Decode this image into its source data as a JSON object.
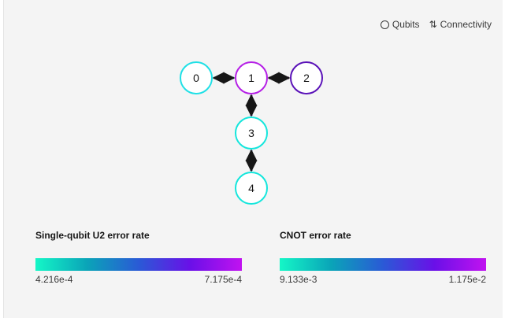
{
  "legend": {
    "qubits_label": "Qubits",
    "connectivity_label": "Connectivity",
    "qubits_icon": "circle-outline-icon",
    "connectivity_icon": "swap-vertical-icon"
  },
  "topology": {
    "nodes": [
      {
        "id": "0",
        "color": "#1fe0e6"
      },
      {
        "id": "1",
        "color": "#b51fe6"
      },
      {
        "id": "2",
        "color": "#5a12b8"
      },
      {
        "id": "3",
        "color": "#14e6dc"
      },
      {
        "id": "4",
        "color": "#14e6dc"
      }
    ],
    "edges": [
      {
        "from": "0",
        "to": "1",
        "color": "#2bbdb8"
      },
      {
        "from": "1",
        "to": "2",
        "color": "#7a1680"
      },
      {
        "from": "1",
        "to": "3",
        "color": "#3c1a8c"
      },
      {
        "from": "3",
        "to": "4",
        "color": "#123a7a"
      }
    ]
  },
  "scales": {
    "single_qubit": {
      "title": "Single-qubit U2 error rate",
      "min": "4.216e-4",
      "max": "7.175e-4"
    },
    "cnot": {
      "title": "CNOT error rate",
      "min": "9.133e-3",
      "max": "1.175e-2"
    },
    "gradient_colors": [
      "#14f7c7",
      "#0aa4b8",
      "#2a5ad6",
      "#6a10e8",
      "#c112f0"
    ]
  }
}
